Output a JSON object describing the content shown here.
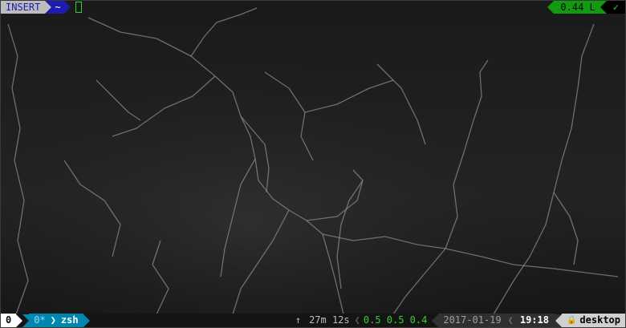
{
  "prompt": {
    "mode": "INSERT",
    "dir": "~"
  },
  "status_right": {
    "load": "0.44 L",
    "ok": "✓"
  },
  "tmux": {
    "session": "0",
    "window_index": "0*",
    "window_name": "zsh",
    "up_arrow": "↑",
    "uptime": "27m 12s",
    "loadavg": "0.5 0.5 0.4",
    "date": "2017-01-19",
    "time": "19:18",
    "lock": "🔒",
    "host": "desktop"
  },
  "colors": {
    "mode_bg": "#bcbcbc",
    "dir_bg": "#1c1cb0",
    "status_green": "#129b12",
    "tmux_session_bg": "#ffffff",
    "tmux_window_bg": "#0087af",
    "loadavg_fg": "#34d034",
    "date_bg": "#303030",
    "time_bg": "#444444",
    "host_bg": "#d0d0d0"
  }
}
